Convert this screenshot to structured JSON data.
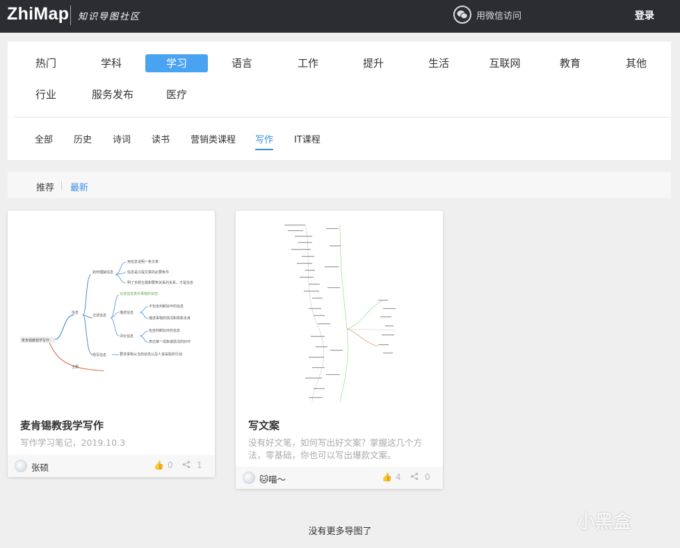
{
  "header": {
    "logo": "ZhiMap",
    "logo_sub": "知识导图社区",
    "wechat_label": "用微信访问",
    "login_label": "登录"
  },
  "categories": {
    "row1": [
      "热门",
      "学科",
      "学习",
      "语言",
      "工作",
      "提升",
      "生活",
      "互联网",
      "教育",
      "其他"
    ],
    "row2": [
      "行业",
      "服务发布",
      "医疗"
    ],
    "active": "学习"
  },
  "subcategories": {
    "items": [
      "全部",
      "历史",
      "诗词",
      "读书",
      "营销类课程",
      "写作",
      "IT课程"
    ],
    "active": "写作"
  },
  "sort": {
    "recommend": "推荐",
    "latest": "最新"
  },
  "cards": [
    {
      "title": "麦肯锡教我学写作",
      "desc": "写作学习笔记，2019.10.3",
      "author": "张硕",
      "likes": "0",
      "shares": "1",
      "mindmap": {
        "root": "麦肯锡教我学写作",
        "branch1": "信息",
        "branch2": "主题",
        "sub1": "如何理解信息",
        "sub2": "记述信息",
        "sub3": "规写信息",
        "leafA": "用信息说明一条文章",
        "leafB": "信息是只提文章的必要条件",
        "leafC": "明了多想主题和要表关系的关系，才是信息",
        "leafD": "记述信息表示事物的状态",
        "mid1": "描述信息",
        "mid2": "评价信息",
        "leafE": "不包含判断好坏的信息",
        "leafF": "描述事物的情况和现象本身",
        "leafG": "包含判断好坏的信息",
        "leafH": "表达某一现象或情况的好坏",
        "leafI": "要求事物从当前状态以及人该采取的行动"
      }
    },
    {
      "title": "写文案",
      "desc": "没有好文笔，如何写出好文案？掌握这几个方法，零基础，你也可以写出爆款文案。",
      "author": "🐱喵～",
      "likes": "4",
      "shares": "0"
    }
  ],
  "footer": {
    "no_more": "没有更多导图了",
    "watermark": "小黑盒"
  }
}
